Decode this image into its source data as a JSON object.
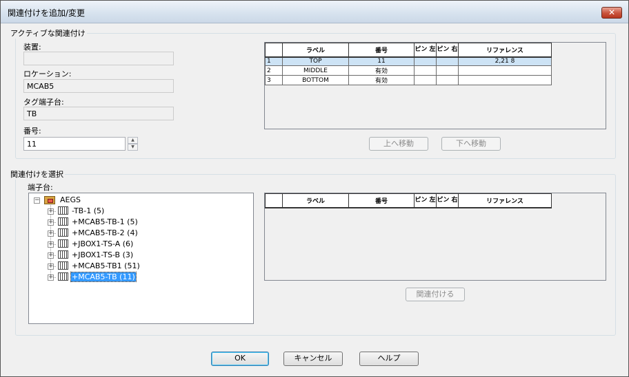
{
  "window": {
    "title": "関連付けを追加/変更",
    "close_label": "✕"
  },
  "active_group": {
    "legend": "アクティブな関連付け",
    "device_label": "装置:",
    "device_value": "",
    "location_label": "ロケーション:",
    "location_value": "MCAB5",
    "tag_strip_label": "タグ端子台:",
    "tag_strip_value": "TB",
    "number_label": "番号:",
    "number_value": "11",
    "table": {
      "headers": [
        "ラベル",
        "番号",
        "ピン 左",
        "ピン 右",
        "リファレンス"
      ],
      "rows": [
        {
          "num": "1",
          "label": "TOP",
          "number": "11",
          "pin_left": "",
          "pin_right": "",
          "reference": "2,21 8"
        },
        {
          "num": "2",
          "label": "MIDDLE",
          "number": "有効",
          "pin_left": "",
          "pin_right": "",
          "reference": ""
        },
        {
          "num": "3",
          "label": "BOTTOM",
          "number": "有効",
          "pin_left": "",
          "pin_right": "",
          "reference": ""
        }
      ]
    },
    "move_up_label": "上へ移動",
    "move_down_label": "下へ移動"
  },
  "select_group": {
    "legend": "関連付けを選択",
    "terminal_strip_label": "端子台:",
    "tree": {
      "root": "AEGS",
      "children": [
        "-TB-1 (5)",
        "+MCAB5-TB-1 (5)",
        "+MCAB5-TB-2 (4)",
        "+JBOX1-TS-A (6)",
        "+JBOX1-TS-B (3)",
        "+MCAB5-TB1 (51)",
        "+MCAB5-TB (11)"
      ]
    },
    "table": {
      "headers": [
        "ラベル",
        "番号",
        "ピン 左",
        "ピン 右",
        "リファレンス"
      ]
    },
    "associate_label": "関連付ける"
  },
  "footer": {
    "ok_label": "OK",
    "cancel_label": "キャンセル",
    "help_label": "ヘルプ"
  }
}
